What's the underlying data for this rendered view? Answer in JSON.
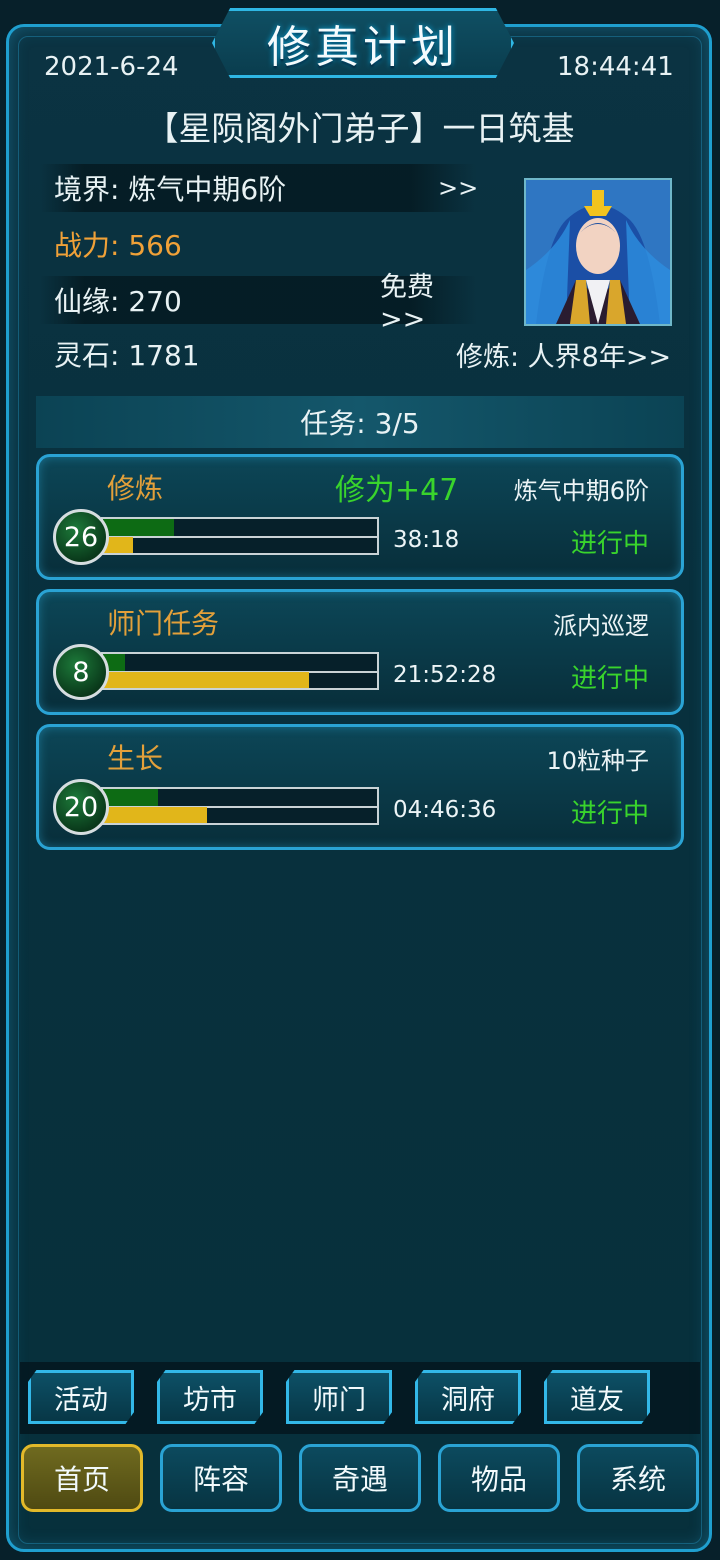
{
  "header": {
    "title": "修真计划",
    "date": "2021-6-24",
    "time": "18:44:41",
    "subtitle": "【星陨阁外门弟子】一日筑基"
  },
  "stats": {
    "realm": {
      "label": "境界: 炼气中期6阶",
      "action": ">>"
    },
    "power": {
      "label": "战力: 566"
    },
    "fate": {
      "label": "仙缘: 270",
      "action": "免费>>"
    },
    "stones": {
      "label": "灵石: 1781"
    },
    "cultivation": {
      "label": "修炼: 人界8年>>"
    }
  },
  "tasks_header": "任务: 3/5",
  "tasks": [
    {
      "name": "修炼",
      "bonus": "修为+47",
      "detail": "炼气中期6阶",
      "level": "26",
      "green_progress": 0.26,
      "yellow_progress": 0.11,
      "timer": "38:18",
      "status": "进行中"
    },
    {
      "name": "师门任务",
      "bonus": "",
      "detail": "派内巡逻",
      "level": "8",
      "green_progress": 0.08,
      "yellow_progress": 0.75,
      "timer": "21:52:28",
      "status": "进行中"
    },
    {
      "name": "生长",
      "bonus": "",
      "detail": "10粒种子",
      "level": "20",
      "green_progress": 0.2,
      "yellow_progress": 0.38,
      "timer": "04:46:36",
      "status": "进行中"
    }
  ],
  "sub_nav": [
    "活动",
    "坊市",
    "师门",
    "洞府",
    "道友"
  ],
  "main_nav": [
    "首页",
    "阵容",
    "奇遇",
    "物品",
    "系统"
  ],
  "colors": {
    "accent": "#2aa3d4",
    "power": "#f0a138",
    "status": "#39d42c",
    "task_name": "#e3a03a",
    "active_tab": "#e2b92a"
  }
}
